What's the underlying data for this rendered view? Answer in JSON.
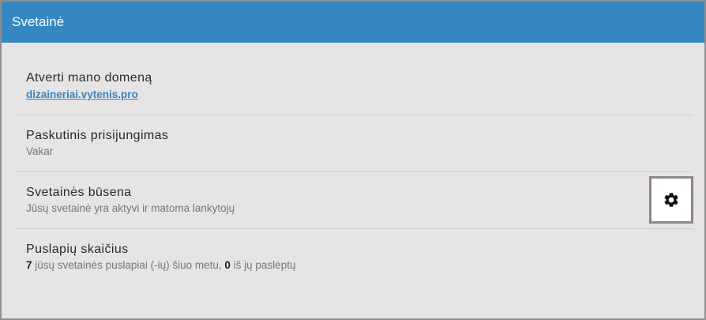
{
  "header": {
    "title": "Svetainė"
  },
  "rows": [
    {
      "title": "Atverti mano domeną",
      "link": "dizaineriai.vytenis.pro"
    },
    {
      "title": "Paskutinis prisijungimas",
      "subtitle": "Vakar"
    },
    {
      "title": "Svetainės būsena",
      "subtitle": "Jūsų svetainė yra aktyvi ir matoma lankytojų",
      "icon": "gear-icon"
    },
    {
      "title": "Puslapių skaičius",
      "count": "7",
      "count_text": " jūsų svetainės puslapiai (-ių) šiuo metu, ",
      "hidden_count": "0",
      "hidden_text": " iš jų paslėptų"
    }
  ]
}
